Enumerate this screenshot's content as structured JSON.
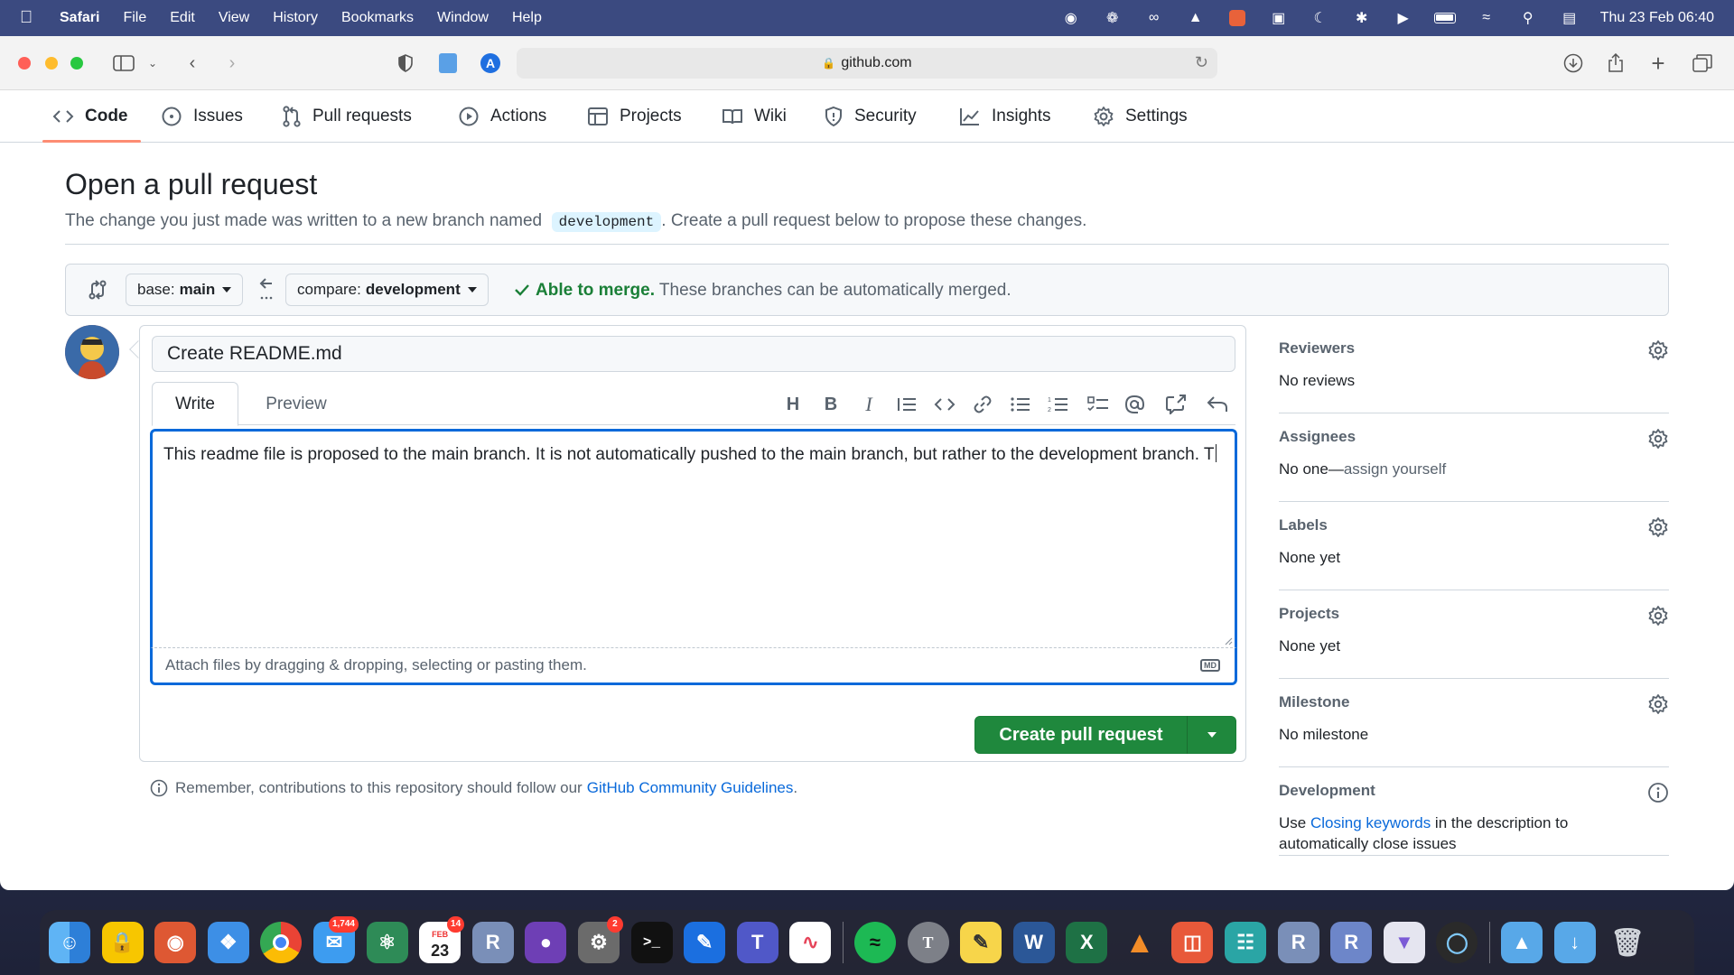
{
  "menubar": {
    "app_name": "Safari",
    "menus": [
      "File",
      "Edit",
      "View",
      "History",
      "Bookmarks",
      "Window",
      "Help"
    ],
    "clock": "Thu 23 Feb  06:40"
  },
  "browser": {
    "url": "github.com"
  },
  "repo_nav": {
    "tabs": [
      {
        "label": "Code",
        "icon": "code-icon",
        "active": true
      },
      {
        "label": "Issues",
        "icon": "issue-icon"
      },
      {
        "label": "Pull requests",
        "icon": "pull-request-icon"
      },
      {
        "label": "Actions",
        "icon": "play-icon"
      },
      {
        "label": "Projects",
        "icon": "table-icon"
      },
      {
        "label": "Wiki",
        "icon": "book-icon"
      },
      {
        "label": "Security",
        "icon": "shield-icon"
      },
      {
        "label": "Insights",
        "icon": "graph-icon"
      },
      {
        "label": "Settings",
        "icon": "gear-icon"
      }
    ]
  },
  "page": {
    "title": "Open a pull request",
    "subtitle_before": "The change you just made was written to a new branch named",
    "branch_name": "development",
    "subtitle_after": ". Create a pull request below to propose these changes."
  },
  "compare": {
    "base_prefix": "base:",
    "base_branch": "main",
    "compare_prefix": "compare:",
    "compare_branch": "development",
    "merge_ok": "Able to merge.",
    "merge_text": "These branches can be automatically merged."
  },
  "form": {
    "title_value": "Create README.md",
    "tab_write": "Write",
    "tab_preview": "Preview",
    "body_value": "This readme file is proposed to the main branch. It is not automatically pushed to the main branch, but rather to the development branch. T",
    "attach_hint": "Attach files by dragging & dropping, selecting or pasting them.",
    "markdown_badge": "MD",
    "submit_label": "Create pull request"
  },
  "guidelines": {
    "text": "Remember, contributions to this repository should follow our",
    "link": "GitHub Community Guidelines",
    "end": "."
  },
  "sidebar": {
    "reviewers": {
      "heading": "Reviewers",
      "value": "No reviews"
    },
    "assignees": {
      "heading": "Assignees",
      "value_prefix": "No one—",
      "value_link": "assign yourself"
    },
    "labels": {
      "heading": "Labels",
      "value": "None yet"
    },
    "projects": {
      "heading": "Projects",
      "value": "None yet"
    },
    "milestone": {
      "heading": "Milestone",
      "value": "No milestone"
    },
    "development": {
      "heading": "Development",
      "value_prefix": "Use ",
      "value_link": "Closing keywords",
      "value_suffix": " in the description to automatically close issues"
    }
  },
  "dock": {
    "mail_badge": "1,744",
    "calendar_month": "FEB",
    "calendar_day": "23",
    "calendar_badge": "14",
    "settings_badge": "2"
  },
  "colors": {
    "accent_blue": "#0969da",
    "primary_green": "#1f883d",
    "success_green": "#1a7f37",
    "tab_underline": "#fd8c73"
  }
}
